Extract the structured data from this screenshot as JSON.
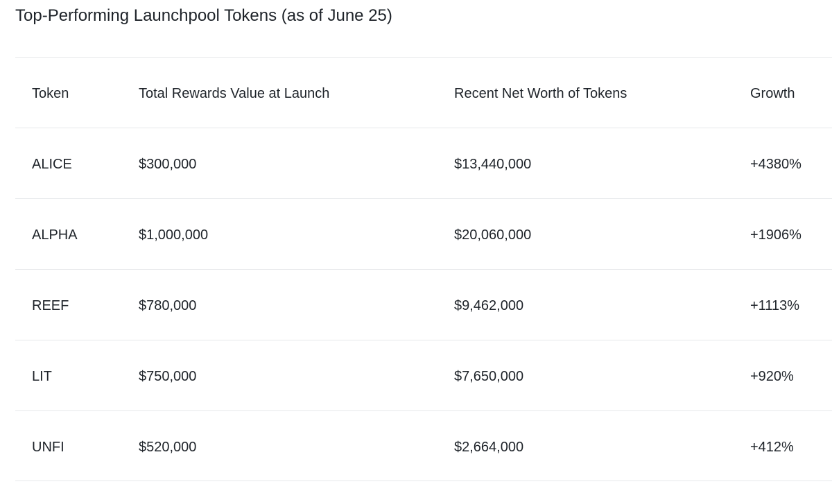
{
  "title": "Top-Performing Launchpool Tokens (as of June 25)",
  "table": {
    "headers": [
      "Token",
      "Total Rewards Value at Launch",
      "Recent Net Worth of Tokens",
      "Growth"
    ],
    "rows": [
      [
        "ALICE",
        "$300,000",
        "$13,440,000",
        "+4380%"
      ],
      [
        "ALPHA",
        "$1,000,000",
        "$20,060,000",
        "+1906%"
      ],
      [
        "REEF",
        "$780,000",
        "$9,462,000",
        "+1113%"
      ],
      [
        "LIT",
        "$750,000",
        "$7,650,000",
        "+920%"
      ],
      [
        "UNFI",
        "$520,000",
        "$2,664,000",
        "+412%"
      ]
    ]
  }
}
